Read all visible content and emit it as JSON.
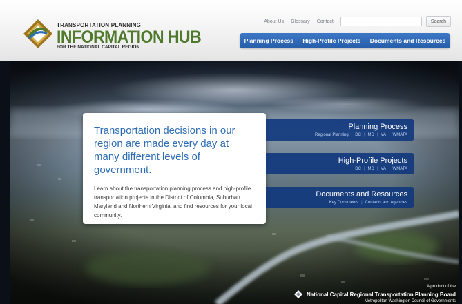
{
  "logo": {
    "line1": "TRANSPORTATION PLANNING",
    "line2": "INFORMATION HUB",
    "line3": "FOR THE NATIONAL CAPITAL REGION"
  },
  "utility": {
    "links": [
      "About Us",
      "Glossary",
      "Contact"
    ],
    "search_placeholder": "",
    "search_label": "Search"
  },
  "nav": [
    "Planning Process",
    "High-Profile Projects",
    "Documents and Resources"
  ],
  "intro": {
    "heading": "Transportation decisions in our region are made every day at many different levels of government.",
    "body": "Learn about the transportation planning process and high-profile transportation projects in the District of Columbia, Suburban Maryland and Northern Virginia, and find resources for your local community."
  },
  "panels": [
    {
      "title": "Planning Process",
      "links": [
        "Regional Planning",
        "DC",
        "MD",
        "VA",
        "WMATA"
      ]
    },
    {
      "title": "High-Profile Projects",
      "links": [
        "DC",
        "MD",
        "VA",
        "WMATA"
      ]
    },
    {
      "title": "Documents and Resources",
      "links": [
        "Key Documents",
        "Contacts and Agencies"
      ]
    }
  ],
  "brand": {
    "pre": "A product of the",
    "name": "National Capital Regional Transportation Planning Board",
    "org": "Metropolitan Washington Council of Governments"
  },
  "colors": {
    "nav_blue": "#2e6db4",
    "logo_green": "#4f7a2c",
    "panel_blue": "#10377d",
    "heading_blue": "#2e6db4"
  }
}
